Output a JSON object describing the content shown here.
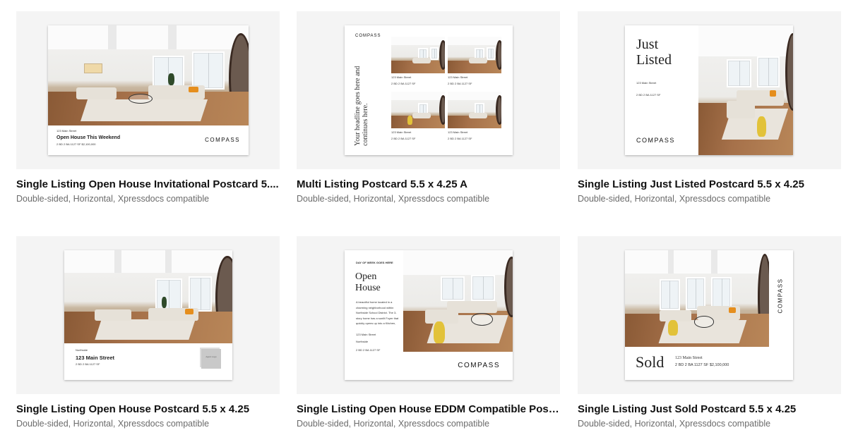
{
  "cards": [
    {
      "title": "Single Listing Open House Invitational Postcard 5....",
      "subtitle": "Double-sided, Horizontal, Xpressdocs compatible",
      "postcard": {
        "address": "123 Main Street",
        "headline": "Open House This Weekend",
        "specs": "2 BD   2 BA   1127 SF   $2,100,000",
        "brand": "COMPASS"
      }
    },
    {
      "title": "Multi Listing Postcard 5.5 x 4.25 A",
      "subtitle": "Double-sided, Horizontal, Xpressdocs compatible",
      "postcard": {
        "brand": "COMPASS",
        "headline": "Your headline goes here and continues here.",
        "listings": [
          {
            "address": "123 Main Street",
            "specs": "2 BD   2 BA   1127 SF"
          },
          {
            "address": "123 Main Street",
            "specs": "2 BD   2 BA   1127 SF"
          },
          {
            "address": "123 Main Street",
            "specs": "2 BD   2 BA   1127 SF"
          },
          {
            "address": "123 Main Street",
            "specs": "2 BD   2 BA   1127 SF"
          }
        ]
      }
    },
    {
      "title": "Single Listing Just Listed Postcard 5.5 x 4.25",
      "subtitle": "Double-sided, Horizontal, Xpressdocs compatible",
      "postcard": {
        "headline_line1": "Just",
        "headline_line2": "Listed",
        "address": "123 Main Street",
        "specs": "2 BD   2 BA   1127 SF",
        "brand": "COMPASS"
      }
    },
    {
      "title": "Single Listing Open House Postcard 5.5 x 4.25",
      "subtitle": "Double-sided, Horizontal, Xpressdocs compatible",
      "postcard": {
        "neighborhood": "Northside",
        "address": "123 Main Street",
        "specs": "2 BD   2 BA   1127 SF",
        "logo_text": "Agent Logo"
      }
    },
    {
      "title": "Single Listing Open House EDDM Compatible Post...",
      "subtitle": "Double-sided, Horizontal, Xpressdocs compatible",
      "postcard": {
        "kicker": "DAY OF WEEK GOES HERE",
        "headline_line1": "Open",
        "headline_line2": "House",
        "body": "A beautiful home located in a charming neighborhood within Northside School District. The 3-story home has a sunlit Foyer that quickly opens up into a Kitchen, Living Room",
        "address": "123 Main Street",
        "neighborhood": "Northside",
        "specs": "2 BD   2 BA   1127 SF",
        "brand": "COMPASS"
      }
    },
    {
      "title": "Single Listing Just Sold Postcard 5.5 x 4.25",
      "subtitle": "Double-sided, Horizontal, Xpressdocs compatible",
      "postcard": {
        "headline": "Sold",
        "address": "123 Main Street",
        "specs": "2 BD   2 BA   1127 SF   $2,100,000",
        "brand": "COMPASS"
      }
    }
  ]
}
